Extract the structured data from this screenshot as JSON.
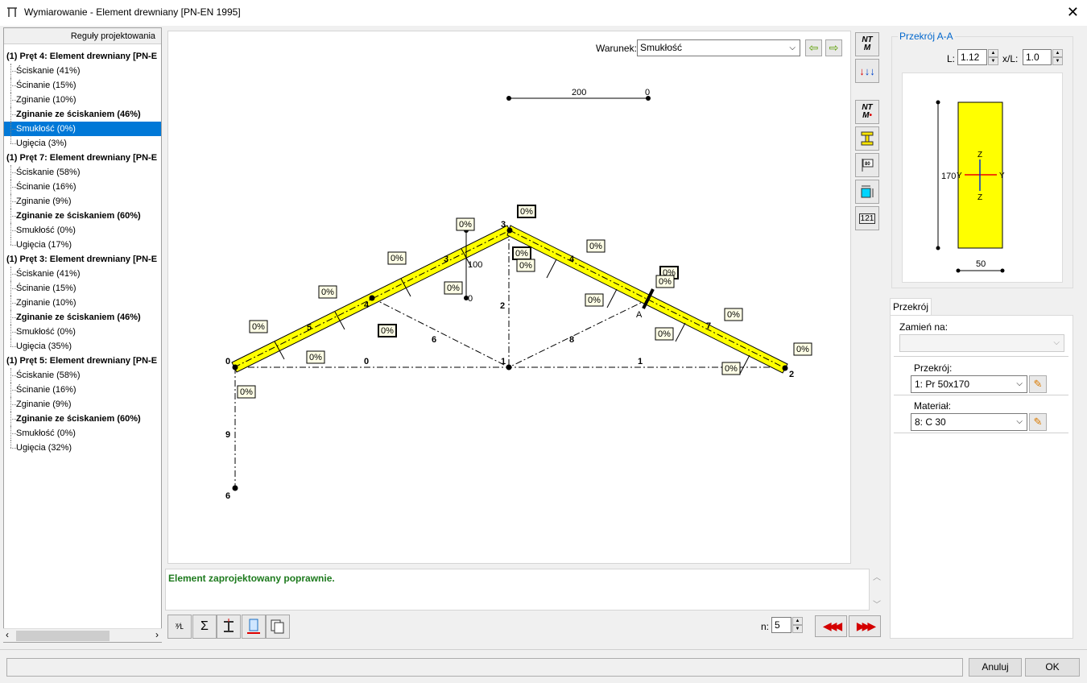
{
  "window": {
    "title": "Wymiarowanie - Element drewniany [PN-EN 1995]",
    "close": "✕"
  },
  "tree": {
    "header": "Reguły projektowania",
    "items": [
      {
        "text": "(1) Pręt 4: Element drewniany [PN-E",
        "type": "group"
      },
      {
        "text": "Ściskanie (41%)",
        "type": "child"
      },
      {
        "text": "Ścinanie (15%)",
        "type": "child"
      },
      {
        "text": "Zginanie (10%)",
        "type": "child"
      },
      {
        "text": "Zginanie ze ściskaniem (46%)",
        "type": "child-bold"
      },
      {
        "text": "Smukłość (0%)",
        "type": "child-sel"
      },
      {
        "text": "Ugięcia (3%)",
        "type": "child-last"
      },
      {
        "text": "(1) Pręt 7: Element drewniany [PN-E",
        "type": "group"
      },
      {
        "text": "Ściskanie (58%)",
        "type": "child"
      },
      {
        "text": "Ścinanie (16%)",
        "type": "child"
      },
      {
        "text": "Zginanie (9%)",
        "type": "child"
      },
      {
        "text": "Zginanie ze ściskaniem (60%)",
        "type": "child-bold"
      },
      {
        "text": "Smukłość (0%)",
        "type": "child"
      },
      {
        "text": "Ugięcia (17%)",
        "type": "child-last"
      },
      {
        "text": "(1) Pręt 3: Element drewniany [PN-E",
        "type": "group"
      },
      {
        "text": "Ściskanie (41%)",
        "type": "child"
      },
      {
        "text": "Ścinanie (15%)",
        "type": "child"
      },
      {
        "text": "Zginanie (10%)",
        "type": "child"
      },
      {
        "text": "Zginanie ze ściskaniem (46%)",
        "type": "child-bold"
      },
      {
        "text": "Smukłość (0%)",
        "type": "child"
      },
      {
        "text": "Ugięcia (35%)",
        "type": "child-last"
      },
      {
        "text": "(1) Pręt 5: Element drewniany [PN-E",
        "type": "group"
      },
      {
        "text": "Ściskanie (58%)",
        "type": "child"
      },
      {
        "text": "Ścinanie (16%)",
        "type": "child"
      },
      {
        "text": "Zginanie (9%)",
        "type": "child"
      },
      {
        "text": "Zginanie ze ściskaniem (60%)",
        "type": "child-bold"
      },
      {
        "text": "Smukłość (0%)",
        "type": "child"
      },
      {
        "text": "Ugięcia (32%)",
        "type": "child-last"
      }
    ]
  },
  "toolbar": {
    "condition_label": "Warunek:",
    "condition_value": "Smukłość"
  },
  "drawing": {
    "scale_label": "200",
    "scale_zero": "0",
    "percent": "0%",
    "height_label": "100",
    "height_zero": "0",
    "nodes": [
      "0",
      "1",
      "2",
      "3",
      "4",
      "6"
    ],
    "bars": [
      "0",
      "1",
      "2",
      "3",
      "4",
      "5",
      "6",
      "7",
      "8",
      "9"
    ],
    "section_mark": "A"
  },
  "message": "Element zaprojektowany poprawnie.",
  "bottom": {
    "n_label": "n:",
    "n_value": "5"
  },
  "section": {
    "title": "Przekrój A-A",
    "L_label": "L:",
    "L_value": "1.12",
    "xL_label": "x/L:",
    "xL_value": "1.0",
    "height": "170",
    "width": "50",
    "axis_y": "Y",
    "axis_z": "Z"
  },
  "panel": {
    "tab": "Przekrój",
    "replace_label": "Zamień na:",
    "replace_value": "",
    "profile_label": "Przekrój:",
    "profile_value": "1: Pr 50x170",
    "material_label": "Materiał:",
    "material_value": "8: C 30"
  },
  "buttons": {
    "cancel": "Anuluj",
    "ok": "OK"
  },
  "colors": {
    "beam": "#ffff00",
    "selection": "#0078d7",
    "message": "#1d7a1d",
    "section_title": "#0066cc"
  }
}
